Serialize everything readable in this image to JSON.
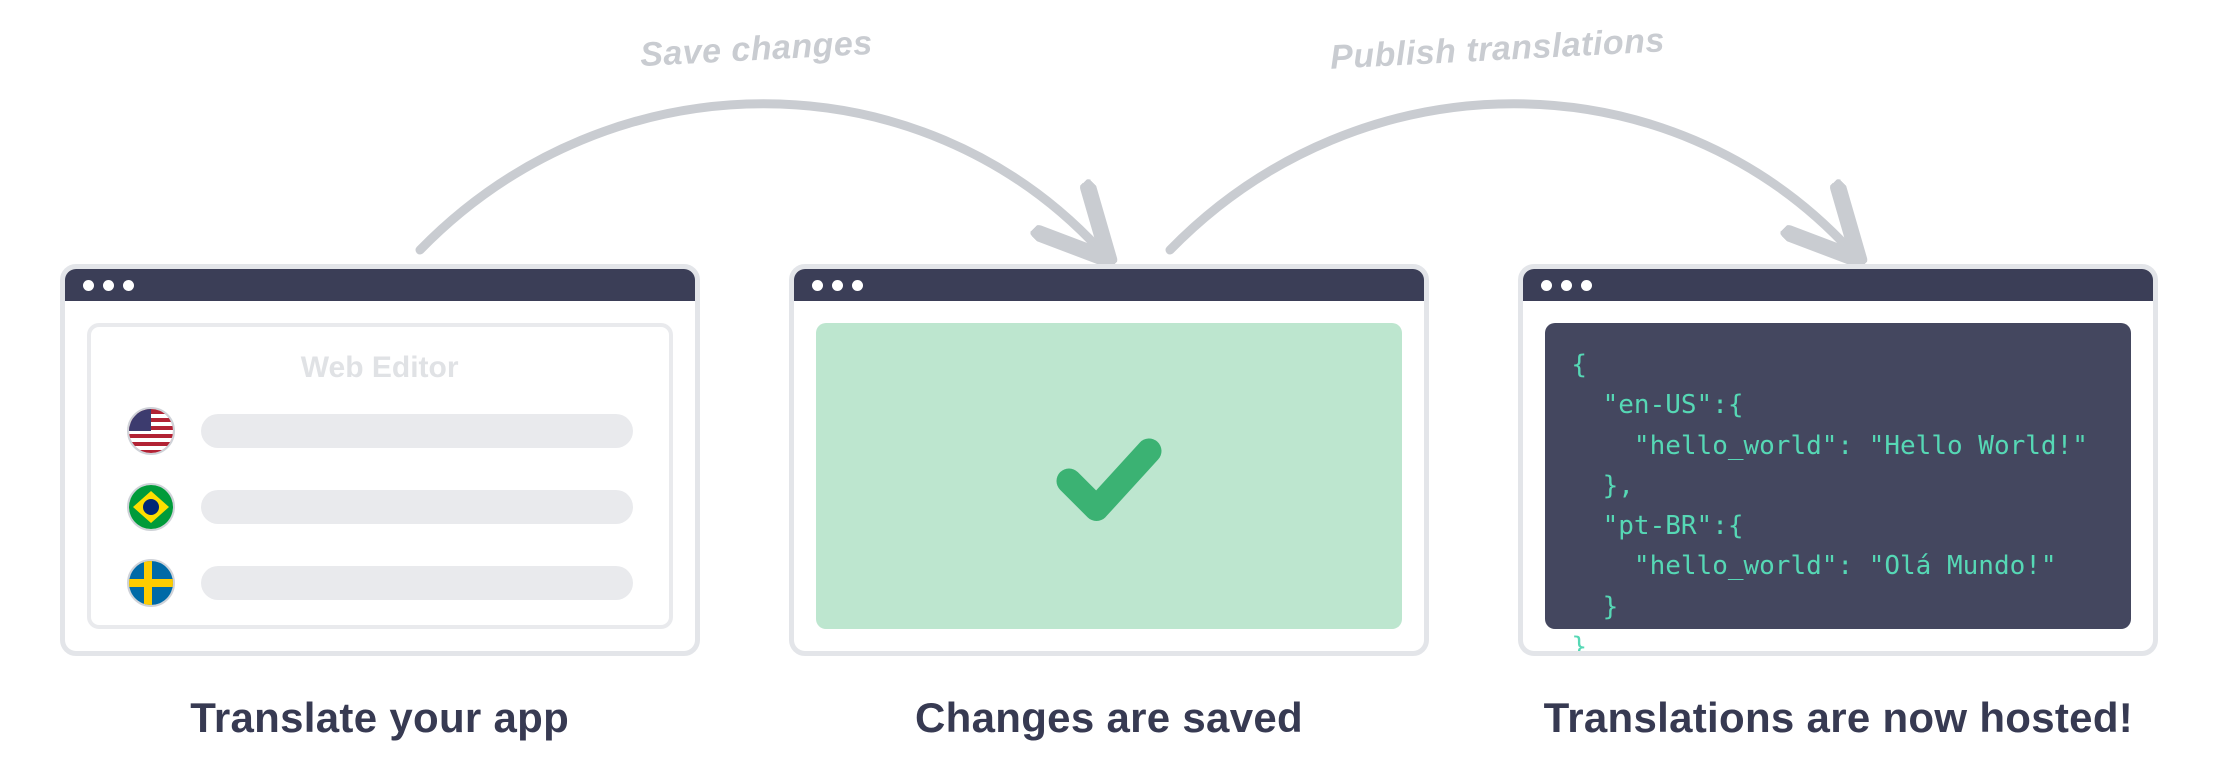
{
  "arcs": {
    "save": "Save changes",
    "publish": "Publish translations"
  },
  "panels": {
    "editor": {
      "title": "Web Editor",
      "rows": [
        "us",
        "br",
        "se"
      ],
      "caption": "Translate your app"
    },
    "saved": {
      "caption": "Changes are saved"
    },
    "hosted": {
      "caption": "Translations are now hosted!",
      "code": "{\n  \"en-US\":{\n    \"hello_world\": \"Hello World!\"\n  },\n  \"pt-BR\":{\n    \"hello_world\": \"Olá Mundo!\"\n  }\n}"
    }
  }
}
